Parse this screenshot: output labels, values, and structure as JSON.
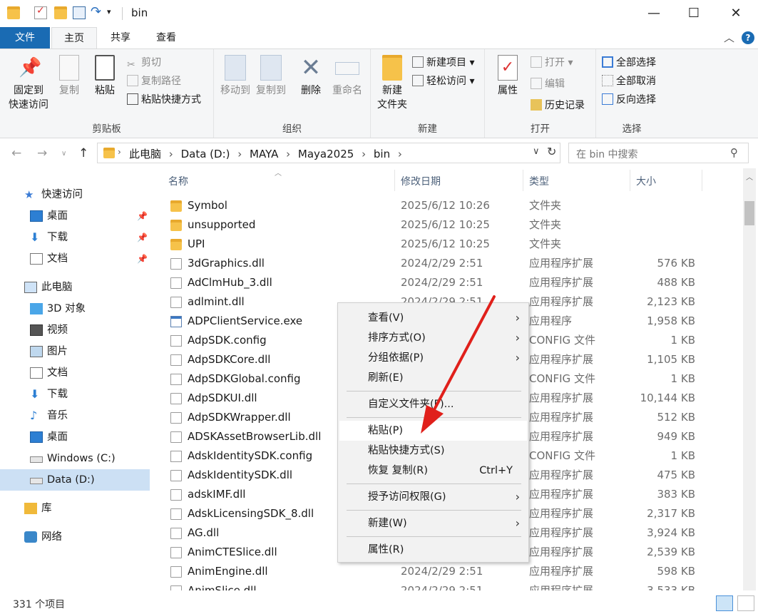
{
  "window": {
    "title": "bin",
    "minimize": "—",
    "maximize": "☐",
    "close": "✕"
  },
  "tabs": {
    "file": "文件",
    "home": "主页",
    "share": "共享",
    "view": "查看"
  },
  "ribbon": {
    "clipboard": {
      "pin": "固定到\n快速访问",
      "pin1": "固定到",
      "pin2": "快速访问",
      "copy": "复制",
      "paste": "粘贴",
      "cut": "剪切",
      "copy_path": "复制路径",
      "paste_shortcut": "粘贴快捷方式",
      "label": "剪贴板"
    },
    "organize": {
      "move_to": "移动到",
      "copy_to": "复制到",
      "delete": "删除",
      "rename": "重命名",
      "label": "组织"
    },
    "new": {
      "new_folder1": "新建",
      "new_folder2": "文件夹",
      "new_item": "新建项目",
      "easy_access": "轻松访问",
      "label": "新建"
    },
    "open": {
      "properties": "属性",
      "open": "打开",
      "edit": "编辑",
      "history": "历史记录",
      "label": "打开"
    },
    "select": {
      "select_all": "全部选择",
      "select_none": "全部取消",
      "invert": "反向选择",
      "label": "选择"
    }
  },
  "address": {
    "crumbs": [
      "此电脑",
      "Data (D:)",
      "MAYA",
      "Maya2025",
      "bin"
    ],
    "search_placeholder": "在 bin 中搜索"
  },
  "nav": [
    {
      "label": "快速访问",
      "icon": "star-icon"
    },
    {
      "label": "桌面",
      "icon": "desktop-icon",
      "pinned": true
    },
    {
      "label": "下载",
      "icon": "download-icon",
      "pinned": true
    },
    {
      "label": "文档",
      "icon": "document-icon",
      "pinned": true
    },
    {
      "label": "此电脑",
      "icon": "pc-icon"
    },
    {
      "label": "3D 对象",
      "icon": "cube-icon"
    },
    {
      "label": "视频",
      "icon": "video-icon"
    },
    {
      "label": "图片",
      "icon": "picture-icon"
    },
    {
      "label": "文档",
      "icon": "document-icon"
    },
    {
      "label": "下载",
      "icon": "download-icon"
    },
    {
      "label": "音乐",
      "icon": "music-icon"
    },
    {
      "label": "桌面",
      "icon": "desktop-icon"
    },
    {
      "label": "Windows (C:)",
      "icon": "drive-icon"
    },
    {
      "label": "Data (D:)",
      "icon": "drive-icon",
      "selected": true
    },
    {
      "label": "库",
      "icon": "library-icon"
    },
    {
      "label": "网络",
      "icon": "network-icon"
    }
  ],
  "columns": {
    "name": "名称",
    "date": "修改日期",
    "type": "类型",
    "size": "大小"
  },
  "files": [
    {
      "name": "Symbol",
      "date": "2025/6/12 10:26",
      "type": "文件夹",
      "size": "",
      "kind": "folder"
    },
    {
      "name": "unsupported",
      "date": "2025/6/12 10:25",
      "type": "文件夹",
      "size": "",
      "kind": "folder"
    },
    {
      "name": "UPI",
      "date": "2025/6/12 10:25",
      "type": "文件夹",
      "size": "",
      "kind": "folder"
    },
    {
      "name": "3dGraphics.dll",
      "date": "2024/2/29 2:51",
      "type": "应用程序扩展",
      "size": "576 KB",
      "kind": "dll"
    },
    {
      "name": "AdClmHub_3.dll",
      "date": "2024/2/29 2:51",
      "type": "应用程序扩展",
      "size": "488 KB",
      "kind": "dll"
    },
    {
      "name": "adlmint.dll",
      "date": "2024/2/29 2:51",
      "type": "应用程序扩展",
      "size": "2,123 KB",
      "kind": "dll"
    },
    {
      "name": "ADPClientService.exe",
      "date": "",
      "type": "应用程序",
      "size": "1,958 KB",
      "kind": "exe"
    },
    {
      "name": "AdpSDK.config",
      "date": "",
      "type": "CONFIG 文件",
      "size": "1 KB",
      "kind": "cfg"
    },
    {
      "name": "AdpSDKCore.dll",
      "date": "",
      "type": "应用程序扩展",
      "size": "1,105 KB",
      "kind": "dll"
    },
    {
      "name": "AdpSDKGlobal.config",
      "date": "",
      "type": "CONFIG 文件",
      "size": "1 KB",
      "kind": "cfg"
    },
    {
      "name": "AdpSDKUI.dll",
      "date": "",
      "type": "应用程序扩展",
      "size": "10,144 KB",
      "kind": "dll"
    },
    {
      "name": "AdpSDKWrapper.dll",
      "date": "",
      "type": "应用程序扩展",
      "size": "512 KB",
      "kind": "dll"
    },
    {
      "name": "ADSKAssetBrowserLib.dll",
      "date": "",
      "type": "应用程序扩展",
      "size": "949 KB",
      "kind": "dll"
    },
    {
      "name": "AdskIdentitySDK.config",
      "date": "",
      "type": "CONFIG 文件",
      "size": "1 KB",
      "kind": "cfg"
    },
    {
      "name": "AdskIdentitySDK.dll",
      "date": "",
      "type": "应用程序扩展",
      "size": "475 KB",
      "kind": "dll"
    },
    {
      "name": "adskIMF.dll",
      "date": "",
      "type": "应用程序扩展",
      "size": "383 KB",
      "kind": "dll"
    },
    {
      "name": "AdskLicensingSDK_8.dll",
      "date": "",
      "type": "应用程序扩展",
      "size": "2,317 KB",
      "kind": "dll"
    },
    {
      "name": "AG.dll",
      "date": "",
      "type": "应用程序扩展",
      "size": "3,924 KB",
      "kind": "dll"
    },
    {
      "name": "AnimCTESlice.dll",
      "date": "",
      "type": "应用程序扩展",
      "size": "2,539 KB",
      "kind": "dll"
    },
    {
      "name": "AnimEngine.dll",
      "date": "2024/2/29 2:51",
      "type": "应用程序扩展",
      "size": "598 KB",
      "kind": "dll"
    },
    {
      "name": "AnimSlice.dll",
      "date": "2024/2/29 2:51",
      "type": "应用程序扩展",
      "size": "3,533 KB",
      "kind": "dll"
    }
  ],
  "context_menu": {
    "view": "查看(V)",
    "sort": "排序方式(O)",
    "group": "分组依据(P)",
    "refresh": "刷新(E)",
    "customize": "自定义文件夹(F)...",
    "paste": "粘贴(P)",
    "paste_shortcut": "粘贴快捷方式(S)",
    "undo": "恢复 复制(R)",
    "undo_shortcut": "Ctrl+Y",
    "grant": "授予访问权限(G)",
    "new": "新建(W)",
    "properties": "属性(R)"
  },
  "status": {
    "count": "331 个项目"
  },
  "colors": {
    "accent": "#1a6bb3",
    "arrow": "#e0201b",
    "selected_nav": "#cce0f4"
  }
}
